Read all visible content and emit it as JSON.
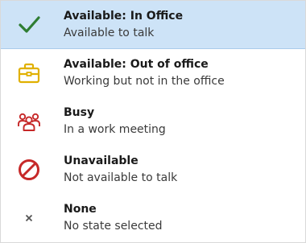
{
  "colors": {
    "selected_background": "#cde3f7",
    "check_green": "#2e7d32",
    "briefcase_yellow": "#e0b000",
    "busy_red": "#c62828",
    "unavailable_red": "#c62828",
    "none_gray": "#555555"
  },
  "items": [
    {
      "icon": "checkmark-icon",
      "title": "Available: In Office",
      "subtitle": "Available to talk",
      "selected": true
    },
    {
      "icon": "briefcase-icon",
      "title": "Available: Out of office",
      "subtitle": "Working but not in the office",
      "selected": false
    },
    {
      "icon": "people-group-icon",
      "title": "Busy",
      "subtitle": "In a work meeting",
      "selected": false
    },
    {
      "icon": "prohibited-icon",
      "title": "Unavailable",
      "subtitle": "Not available to talk",
      "selected": false
    },
    {
      "icon": "close-icon",
      "title": "None",
      "subtitle": "No state selected",
      "selected": false
    }
  ]
}
